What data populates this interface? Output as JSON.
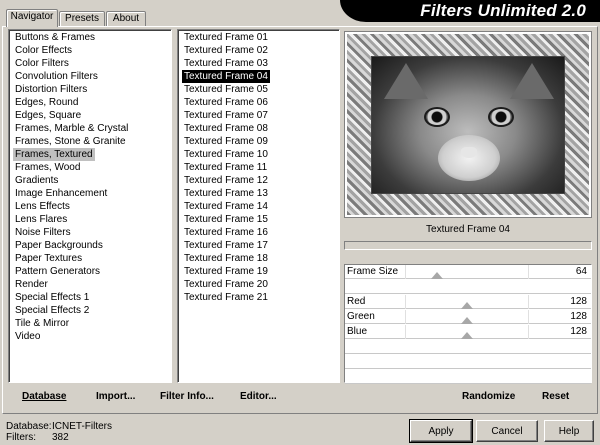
{
  "app": {
    "title": "Filters Unlimited 2.0"
  },
  "tabs": [
    "Navigator",
    "Presets",
    "About"
  ],
  "categories": [
    "Buttons & Frames",
    "Color Effects",
    "Color Filters",
    "Convolution Filters",
    "Distortion Filters",
    "Edges, Round",
    "Edges, Square",
    "Frames, Marble & Crystal",
    "Frames, Stone & Granite",
    "Frames, Textured",
    "Frames, Wood",
    "Gradients",
    "Image Enhancement",
    "Lens Effects",
    "Lens Flares",
    "Noise Filters",
    "Paper Backgrounds",
    "Paper Textures",
    "Pattern Generators",
    "Render",
    "Special Effects 1",
    "Special Effects 2",
    "Tile & Mirror",
    "Video"
  ],
  "selected_category": "Frames, Textured",
  "filters": [
    "Textured Frame 01",
    "Textured Frame 02",
    "Textured Frame 03",
    "Textured Frame 04",
    "Textured Frame 05",
    "Textured Frame 06",
    "Textured Frame 07",
    "Textured Frame 08",
    "Textured Frame 09",
    "Textured Frame 10",
    "Textured Frame 11",
    "Textured Frame 12",
    "Textured Frame 13",
    "Textured Frame 14",
    "Textured Frame 15",
    "Textured Frame 16",
    "Textured Frame 17",
    "Textured Frame 18",
    "Textured Frame 19",
    "Textured Frame 20",
    "Textured Frame 21"
  ],
  "selected_filter": "Textured Frame 04",
  "preview": {
    "caption": "Textured Frame 04"
  },
  "params": [
    {
      "label": "Frame Size",
      "value": "64",
      "level": 0.25
    },
    {
      "label": "Red",
      "value": "128",
      "level": 0.5
    },
    {
      "label": "Green",
      "value": "128",
      "level": 0.5
    },
    {
      "label": "Blue",
      "value": "128",
      "level": 0.5
    }
  ],
  "links": {
    "database": "Database",
    "import": "Import...",
    "filter_info": "Filter Info...",
    "editor": "Editor...",
    "randomize": "Randomize",
    "reset": "Reset"
  },
  "status": {
    "database_label": "Database:",
    "database_value": "ICNET-Filters",
    "filters_label": "Filters:",
    "filters_value": "382"
  },
  "buttons": {
    "apply": "Apply",
    "cancel": "Cancel",
    "help": "Help"
  }
}
